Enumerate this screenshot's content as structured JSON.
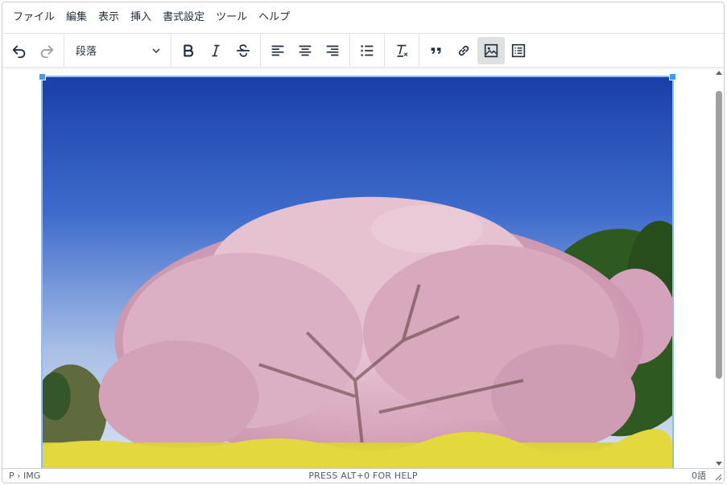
{
  "menubar": {
    "items": [
      "ファイル",
      "編集",
      "表示",
      "挿入",
      "書式設定",
      "ツール",
      "ヘルプ"
    ]
  },
  "toolbar": {
    "block_format": "段落",
    "buttons": [
      {
        "name": "undo-button",
        "icon": "undo-icon",
        "state": "enabled"
      },
      {
        "name": "redo-button",
        "icon": "redo-icon",
        "state": "disabled"
      },
      {
        "name": "bold-button",
        "icon": "bold-icon"
      },
      {
        "name": "italic-button",
        "icon": "italic-icon"
      },
      {
        "name": "strikethrough-button",
        "icon": "strikethrough-icon"
      },
      {
        "name": "align-left-button",
        "icon": "align-left-icon"
      },
      {
        "name": "align-center-button",
        "icon": "align-center-icon"
      },
      {
        "name": "align-right-button",
        "icon": "align-right-icon"
      },
      {
        "name": "bullet-list-button",
        "icon": "bullet-list-icon"
      },
      {
        "name": "clear-format-button",
        "icon": "clear-format-icon"
      },
      {
        "name": "blockquote-button",
        "icon": "quote-icon"
      },
      {
        "name": "link-button",
        "icon": "link-icon"
      },
      {
        "name": "image-button",
        "icon": "image-icon",
        "state": "active"
      },
      {
        "name": "table-of-contents-button",
        "icon": "toc-icon"
      }
    ]
  },
  "content": {
    "image": {
      "subject": "cherry-blossom-tree-photo",
      "selected": true
    }
  },
  "statusbar": {
    "path": "P › IMG",
    "help": "PRESS ALT+0 FOR HELP",
    "wordcount": "0語"
  },
  "colors": {
    "accent": "#4099ff",
    "text": "#222f3e",
    "border": "#cccccc",
    "active_button_bg": "#dee0e2"
  }
}
